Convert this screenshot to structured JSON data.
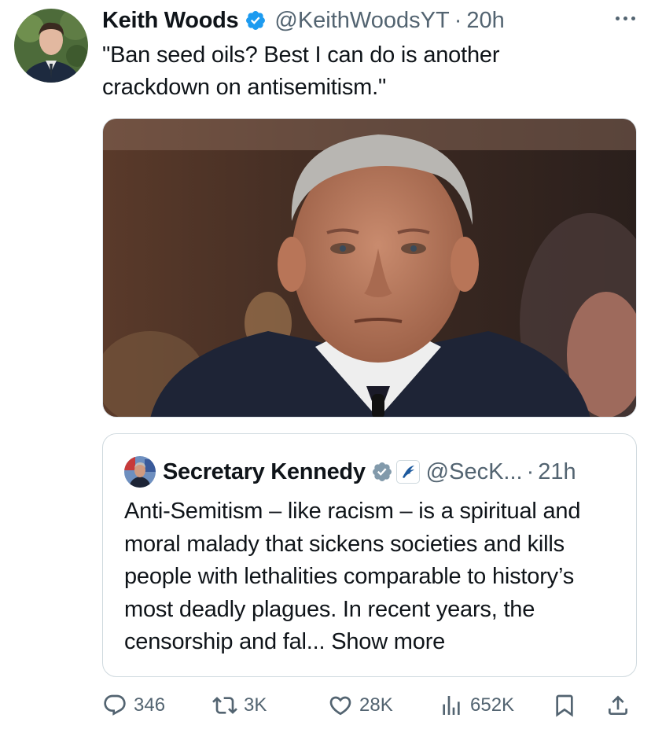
{
  "tweet": {
    "author_name": "Keith Woods",
    "handle": "@KeithWoodsYT",
    "separator": "·",
    "time": "20h",
    "text": "\"Ban seed oils? Best I can do is another crackdown on antisemitism.\""
  },
  "quote": {
    "author_name": "Secretary Kennedy",
    "handle": "@SecK...",
    "separator": "·",
    "time": "21h",
    "text": "Anti-Semitism – like racism – is a spiritual and moral malady that sickens societies and kills people with lethalities comparable to history’s most deadly plagues. In recent years, the censorship and fal...",
    "show_more": "Show more"
  },
  "actions": {
    "replies": "346",
    "reposts": "3K",
    "likes": "28K",
    "views": "652K"
  },
  "icons": {
    "verified": "verified-badge-icon",
    "org": "hhs-eagle-icon",
    "more": "more-dots-icon",
    "reply": "reply-icon",
    "repost": "repost-icon",
    "like": "heart-icon",
    "views": "views-chart-icon",
    "bookmark": "bookmark-icon",
    "share": "share-icon"
  },
  "colors": {
    "text": "#0f1419",
    "secondary": "#536471",
    "verified_blue": "#1d9bf0",
    "verified_gray": "#829aab",
    "border": "#cfd9de"
  }
}
